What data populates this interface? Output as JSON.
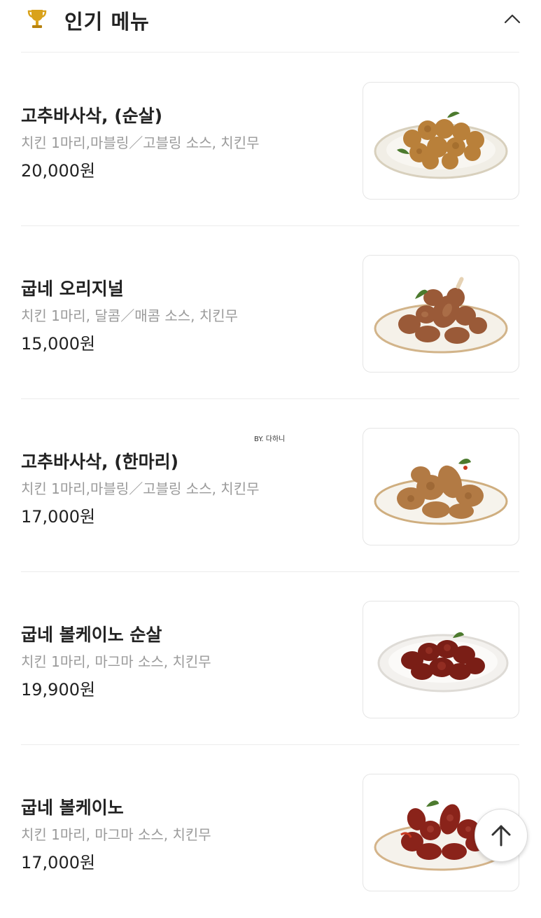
{
  "header": {
    "title": "인기 메뉴",
    "trophy_icon": "trophy-icon",
    "collapse_icon": "chevron-up-icon"
  },
  "watermark": "BY. 다하니",
  "menu": [
    {
      "name": "고추바사삭, (순살)",
      "desc": "치킨 1마리,마블링／고블링 소스, 치킨무",
      "price": "20,000원"
    },
    {
      "name": "굽네 오리지널",
      "desc": "치킨 1마리, 달콤／매콤 소스, 치킨무",
      "price": "15,000원"
    },
    {
      "name": "고추바사삭, (한마리)",
      "desc": "치킨 1마리,마블링／고블링 소스, 치킨무",
      "price": "17,000원"
    },
    {
      "name": "굽네 볼케이노 순살",
      "desc": "치킨 1마리, 마그마 소스, 치킨무",
      "price": "19,900원"
    },
    {
      "name": "굽네 볼케이노",
      "desc": "치킨 1마리, 마그마 소스, 치킨무",
      "price": "17,000원"
    }
  ],
  "scroll_top_icon": "arrow-up-icon",
  "colors": {
    "trophy": "#d9a21b",
    "fried": "#b9803a",
    "roast": "#9a5a38",
    "volcano": "#7a1e16",
    "text_muted": "#9a9a9a"
  }
}
